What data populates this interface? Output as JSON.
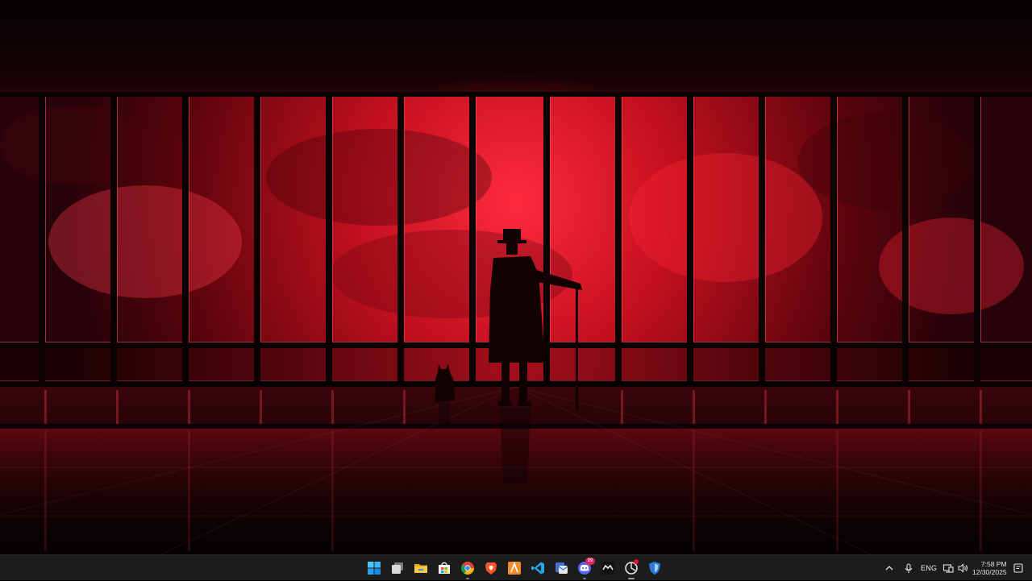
{
  "taskbar": {
    "apps": [
      {
        "name": "start",
        "icon": "windows-start-icon",
        "state": "none"
      },
      {
        "name": "task-view",
        "icon": "task-view-icon",
        "state": "none"
      },
      {
        "name": "file-explorer",
        "icon": "folder-icon",
        "state": "none"
      },
      {
        "name": "microsoft-store",
        "icon": "store-icon",
        "state": "none"
      },
      {
        "name": "chrome",
        "icon": "chrome-icon",
        "state": "open"
      },
      {
        "name": "brave",
        "icon": "brave-icon",
        "state": "none"
      },
      {
        "name": "app-a",
        "icon": "a-app-icon",
        "state": "none"
      },
      {
        "name": "vscode",
        "icon": "vscode-icon",
        "state": "none"
      },
      {
        "name": "mail-app",
        "icon": "mail-app-icon",
        "state": "none"
      },
      {
        "name": "discord",
        "icon": "discord-icon",
        "state": "open",
        "badge": "99"
      },
      {
        "name": "game-app",
        "icon": "controller-icon",
        "state": "none"
      },
      {
        "name": "browser-app",
        "icon": "circle-app-icon",
        "state": "active",
        "dot": true
      },
      {
        "name": "shield-app",
        "icon": "shield-icon",
        "state": "none"
      }
    ],
    "tray": {
      "language": "ENG",
      "time": "7:58 PM",
      "date": "12/30/2025"
    }
  },
  "colors": {
    "taskbar_bg": "#1c1c1c",
    "wallpaper_red": "#c4101f",
    "wallpaper_bright": "#ff2a3d",
    "accent_windows": "#4cc2ff"
  }
}
